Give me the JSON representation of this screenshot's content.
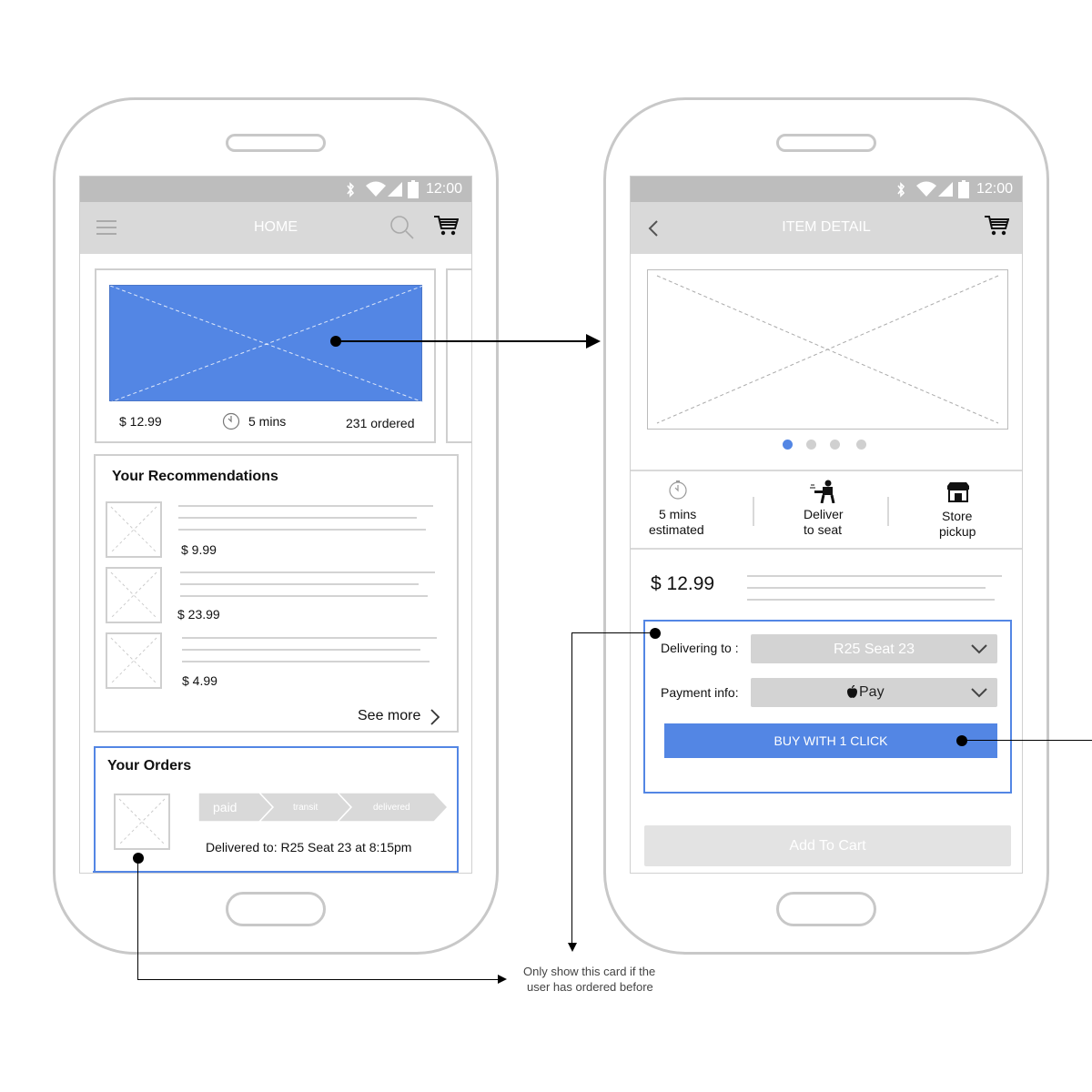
{
  "status": {
    "time": "12:00"
  },
  "home": {
    "title": "HOME",
    "featured": {
      "price": "$ 12.99",
      "time": "5 mins",
      "ordered": "231 ordered"
    },
    "recommendations": {
      "heading": "Your Recommendations",
      "items": [
        {
          "price": "$ 9.99"
        },
        {
          "price": "$ 23.99"
        },
        {
          "price": "$ 4.99"
        }
      ],
      "see_more": "See more"
    },
    "orders": {
      "heading": "Your Orders",
      "steps": [
        "paid",
        "transit",
        "delivered"
      ],
      "delivered_text": "Delivered to: R25 Seat 23 at 8:15pm"
    }
  },
  "detail": {
    "title": "ITEM DETAIL",
    "carousel": {
      "count": 4,
      "active": 0
    },
    "options": [
      {
        "line1": "5 mins",
        "line2": "estimated",
        "icon": "timer-icon"
      },
      {
        "line1": "Deliver",
        "line2": "to seat",
        "icon": "delivery-person-icon"
      },
      {
        "line1": "Store",
        "line2": "pickup",
        "icon": "store-icon"
      }
    ],
    "price": "$ 12.99",
    "delivering_label": "Delivering to :",
    "delivering_value": "R25 Seat 23",
    "payment_label": "Payment info:",
    "payment_value": "Pay",
    "buy_button": "BUY WITH 1 CLICK",
    "add_to_cart": "Add To Cart"
  },
  "annotation": {
    "line1": "Only show this card if the",
    "line2": "user has ordered before"
  },
  "colors": {
    "accent": "#5386e4",
    "gray": "#d9d9d9",
    "status": "#bdbdbd"
  }
}
